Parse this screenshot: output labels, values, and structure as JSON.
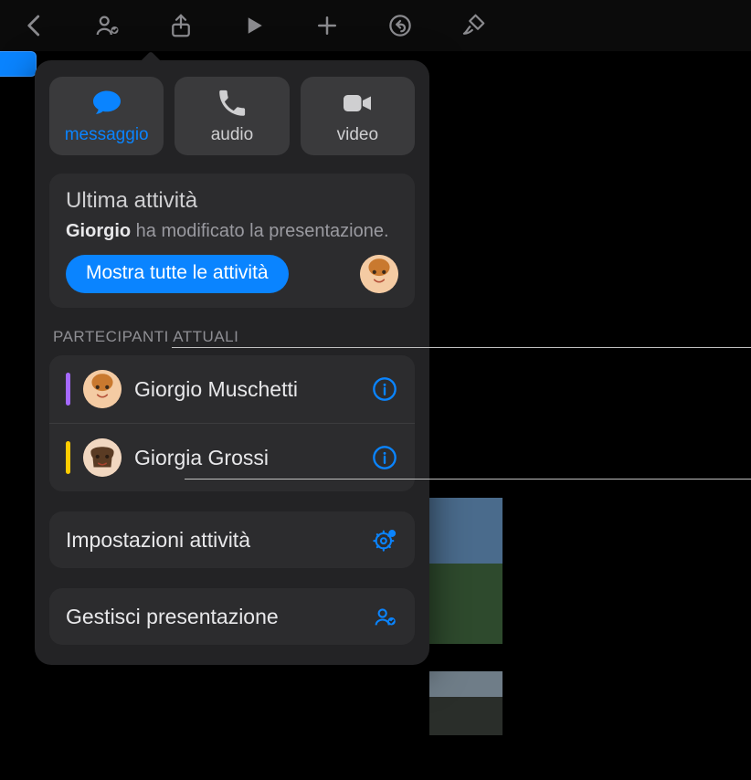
{
  "comm": {
    "message": "messaggio",
    "audio": "audio",
    "video": "video"
  },
  "activity": {
    "header": "Ultima attività",
    "actor": "Giorgio",
    "rest": " ha modificato la presentazione.",
    "button": "Mostra tutte le attività"
  },
  "participants": {
    "header": "PARTECIPANTI ATTUALI",
    "list": [
      {
        "name": "Giorgio Muschetti",
        "accent": "#a569ff"
      },
      {
        "name": "Giorgia Grossi",
        "accent": "#ffcc00"
      }
    ]
  },
  "settings": {
    "activity": "Impostazioni attività",
    "manage": "Gestisci presentazione"
  }
}
